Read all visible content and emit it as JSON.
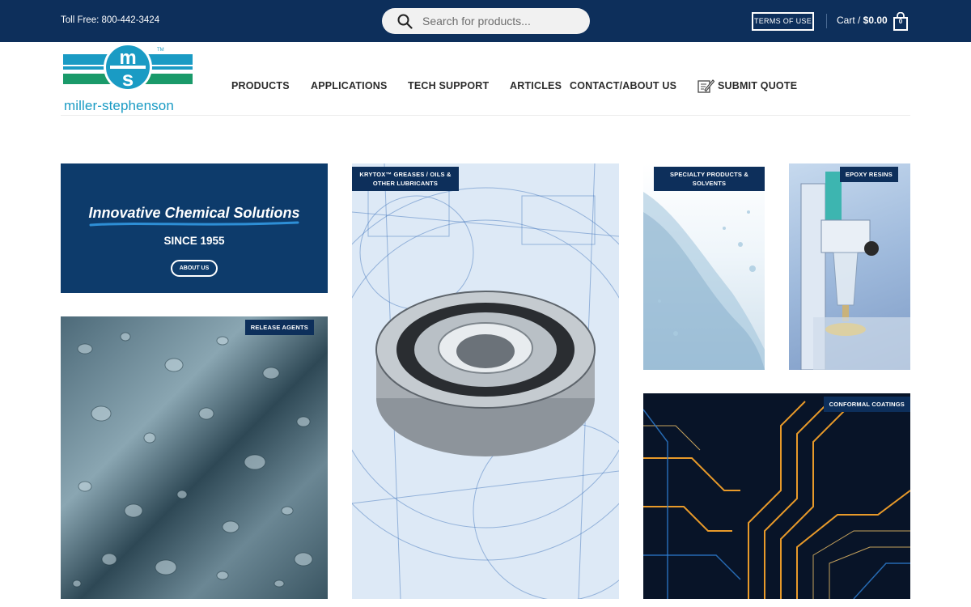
{
  "topbar": {
    "toll_free": "Toll Free: 800-442-3424",
    "search_placeholder": "Search for products...",
    "terms_label": "TERMS OF USE",
    "cart_prefix": "Cart / ",
    "cart_amount": "$0.00",
    "cart_count": "0"
  },
  "header": {
    "logo_text": "miller-stephenson",
    "logo_mark": "ms",
    "trademark": "TM",
    "nav": [
      "PRODUCTS",
      "APPLICATIONS",
      "TECH SUPPORT",
      "ARTICLES",
      "CONTACT/ABOUT US",
      "SUBMIT QUOTE"
    ]
  },
  "hero": {
    "title": "Innovative Chemical Solutions",
    "since": "SINCE 1955",
    "button": "ABOUT US"
  },
  "tiles": {
    "krytox_line1": "KRYTOX™ GREASES / OILS &",
    "krytox_line2": "OTHER LUBRICANTS",
    "specialty_line1": "SPECIALTY PRODUCTS &",
    "specialty_line2": "SOLVENTS",
    "epoxy": "EPOXY RESINS",
    "release": "RELEASE AGENTS",
    "conformal": "CONFORMAL COATINGS"
  },
  "colors": {
    "navy": "#0d2f5b",
    "logo_blue": "#1a9bc4",
    "logo_green": "#1a9a6a"
  },
  "icons": [
    "search-icon",
    "cart-icon",
    "quote-icon",
    "ms-logo"
  ]
}
